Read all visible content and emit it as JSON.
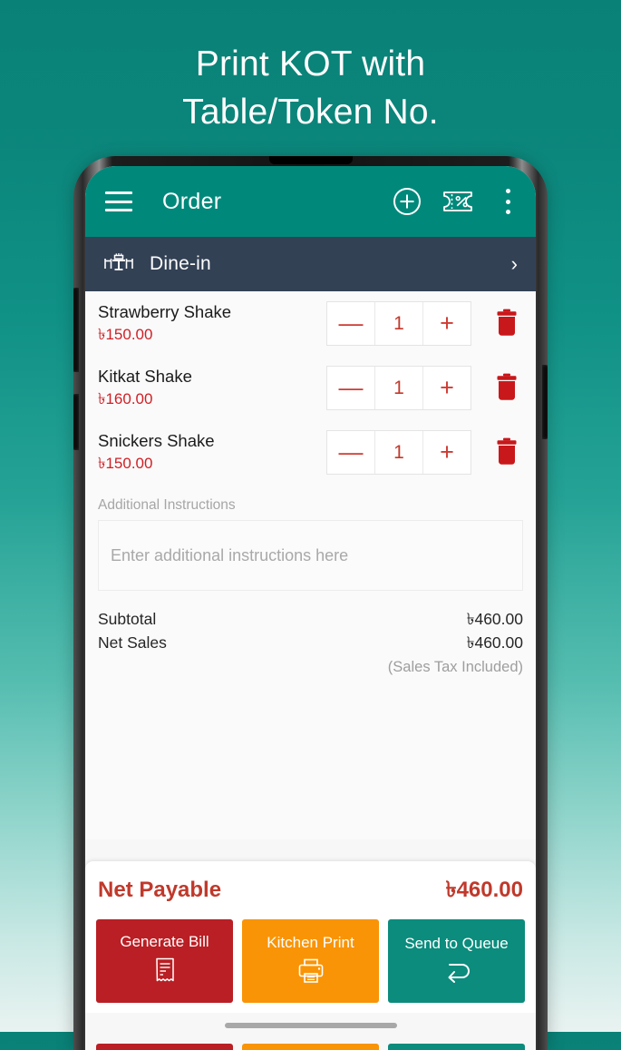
{
  "promo": {
    "headline_line1": "Print KOT with",
    "headline_line2": "Table/Token No."
  },
  "appbar": {
    "title": "Order",
    "menu_icon": "hamburger-menu-icon",
    "add_icon": "add-circle-icon",
    "discount_icon": "discount-ticket-icon",
    "overflow_icon": "more-vertical-icon"
  },
  "order_type": {
    "icon": "dine-in-table-icon",
    "label": "Dine-in",
    "chevron": "›"
  },
  "items": [
    {
      "name": "Strawberry Shake",
      "price": "৳150.00",
      "qty": "1",
      "minus": "—",
      "plus": "+"
    },
    {
      "name": "Kitkat Shake",
      "price": "৳160.00",
      "qty": "1",
      "minus": "—",
      "plus": "+"
    },
    {
      "name": "Snickers Shake",
      "price": "৳150.00",
      "qty": "1",
      "minus": "—",
      "plus": "+"
    }
  ],
  "instructions": {
    "label": "Additional Instructions",
    "placeholder": "Enter additional instructions here",
    "value": ""
  },
  "totals": {
    "subtotal_label": "Subtotal",
    "subtotal_value": "৳460.00",
    "net_sales_label": "Net Sales",
    "net_sales_value": "৳460.00",
    "tax_note": "(Sales Tax Included)"
  },
  "footer": {
    "net_payable_label": "Net Payable",
    "net_payable_value": "৳460.00",
    "buttons": [
      {
        "label": "Generate Bill",
        "icon": "receipt-icon",
        "color": "#b91f24"
      },
      {
        "label": "Kitchen Print",
        "icon": "printer-icon",
        "color": "#f99406"
      },
      {
        "label": "Send to Queue",
        "icon": "return-arrow-icon",
        "color": "#0b8c7d"
      }
    ]
  },
  "colors": {
    "background_top": "#0a8177",
    "background_bottom": "#e9f3f1",
    "appbar": "#00897b",
    "order_type_bar": "#334155",
    "accent_red": "#c0392b",
    "price_red": "#cf2026",
    "orange": "#f99406",
    "teal": "#0b8c7d"
  }
}
